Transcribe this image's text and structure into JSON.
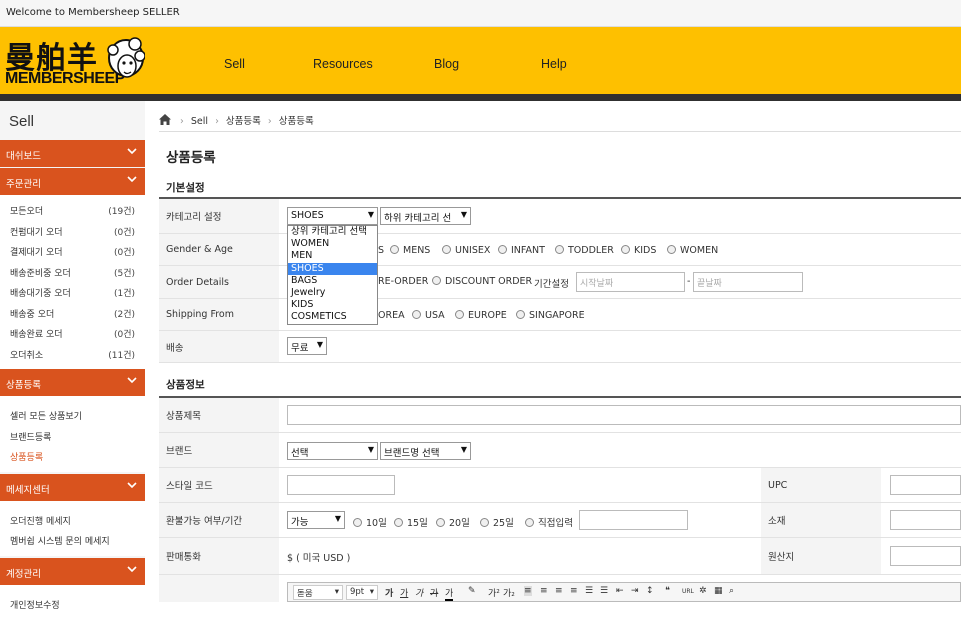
{
  "topbar": {
    "welcome": "Welcome to Membersheep SELLER"
  },
  "logo": {
    "cn": "曼舶羊",
    "en": "MEMBERSHEEP"
  },
  "nav": [
    {
      "label": "Sell"
    },
    {
      "label": "Resources"
    },
    {
      "label": "Blog"
    },
    {
      "label": "Help"
    }
  ],
  "sidebar": {
    "title": "Sell",
    "sections": [
      {
        "label": "대쉬보드"
      },
      {
        "label": "주문관리"
      },
      {
        "label": "상품등록"
      },
      {
        "label": "메세지센터"
      },
      {
        "label": "계정관리"
      }
    ],
    "orders": [
      {
        "label": "모든오더",
        "count": "(19건)"
      },
      {
        "label": "컨펌대기 오더",
        "count": "(0건)"
      },
      {
        "label": "결제대기 오더",
        "count": "(0건)"
      },
      {
        "label": "배송준비중 오더",
        "count": "(5건)"
      },
      {
        "label": "배송대기중 오더",
        "count": "(1건)"
      },
      {
        "label": "배송중 오더",
        "count": "(2건)"
      },
      {
        "label": "배송완료 오더",
        "count": "(0건)"
      },
      {
        "label": "오더취소",
        "count": "(11건)"
      }
    ],
    "products": [
      {
        "label": "셀러 모든 상품보기"
      },
      {
        "label": "브랜드등록"
      },
      {
        "label": "상품등록"
      }
    ],
    "messages": [
      {
        "label": "오더진행 메세지"
      },
      {
        "label": "멤버쉽 시스템 문의 메세지"
      }
    ],
    "account": [
      {
        "label": "개인정보수정"
      }
    ]
  },
  "breadcrumb": [
    "Sell",
    "상품등록",
    "상품등록"
  ],
  "page_title": "상품등록",
  "basic": {
    "title": "기본설정",
    "category_label": "카테고리 설정",
    "category_value": "SHOES",
    "subcategory_value": "하위 카테고리 선",
    "category_options": [
      "상위 카테고리 선택",
      "WOMEN",
      "MEN",
      "SHOES",
      "BAGS",
      "Jewelry",
      "KIDS",
      "COSMETICS"
    ],
    "gender_label": "Gender & Age",
    "gender_options": [
      "MENS",
      "UNISEX",
      "INFANT",
      "TODDLER",
      "KIDS",
      "WOMEN"
    ],
    "gender_partial": "S",
    "order_label": "Order Details",
    "order_partial": "RE-ORDER",
    "order_discount": "DISCOUNT ORDER",
    "period_label": "기간설정",
    "start_placeholder": "시작날짜",
    "dash": "-",
    "end_placeholder": "끝날짜",
    "shipping_from_label": "Shipping From",
    "ship_partial": "OREA",
    "ship_options": [
      "USA",
      "EUROPE",
      "SINGAPORE"
    ],
    "delivery_label": "배송",
    "delivery_value": "무료"
  },
  "product": {
    "title": "상품정보",
    "name_label": "상품제목",
    "brand_label": "브랜드",
    "brand_value": "선택",
    "brand_name_value": "브랜드명 선택",
    "style_label": "스타일 코드",
    "upc_label": "UPC",
    "refund_label": "환불가능 여부/기간",
    "refund_value": "가능",
    "refund_options": [
      "10일",
      "15일",
      "20일",
      "25일",
      "직접입력"
    ],
    "material_label": "소재",
    "currency_label": "판매통화",
    "currency_value": "$ ( 미국 USD )",
    "origin_label": "원산지"
  },
  "editor": {
    "font": "돋움",
    "size": "9pt"
  }
}
